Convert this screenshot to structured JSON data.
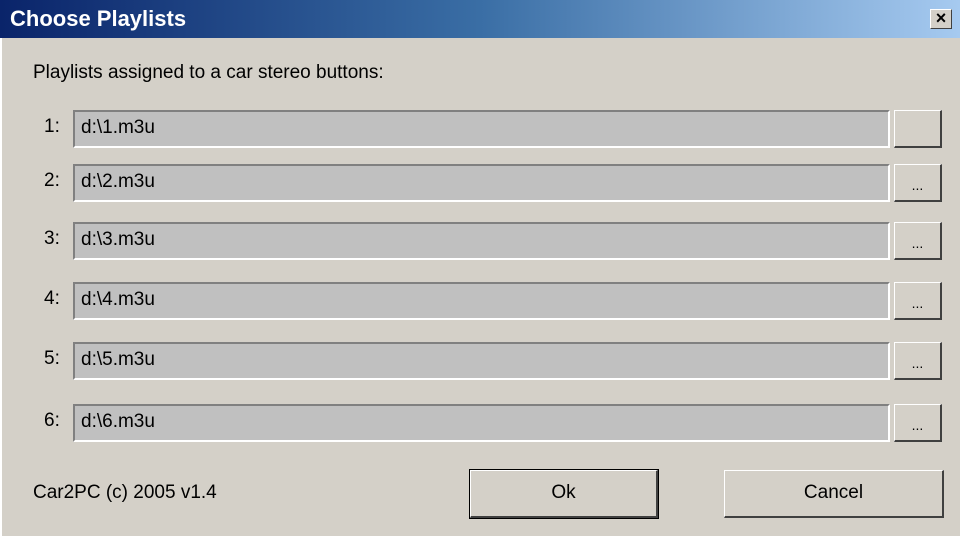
{
  "window": {
    "title": "Choose Playlists",
    "close_label": "×"
  },
  "instruction": "Playlists assigned to a car stereo buttons:",
  "playlists": [
    {
      "num": "1:",
      "path": "d:\\1.m3u",
      "browse_label": ""
    },
    {
      "num": "2:",
      "path": "d:\\2.m3u",
      "browse_label": "..."
    },
    {
      "num": "3:",
      "path": "d:\\3.m3u",
      "browse_label": "..."
    },
    {
      "num": "4:",
      "path": "d:\\4.m3u",
      "browse_label": "..."
    },
    {
      "num": "5:",
      "path": "d:\\5.m3u",
      "browse_label": "..."
    },
    {
      "num": "6:",
      "path": "d:\\6.m3u",
      "browse_label": "..."
    }
  ],
  "footer": {
    "copyright": "Car2PC (c) 2005 v1.4",
    "ok_label": "Ok",
    "cancel_label": "Cancel"
  },
  "colors": {
    "dialog_bg": "#d4d0c8",
    "titlebar_start": "#0a246a",
    "titlebar_end": "#a6caf0",
    "field_bg": "#c0c0c0"
  }
}
